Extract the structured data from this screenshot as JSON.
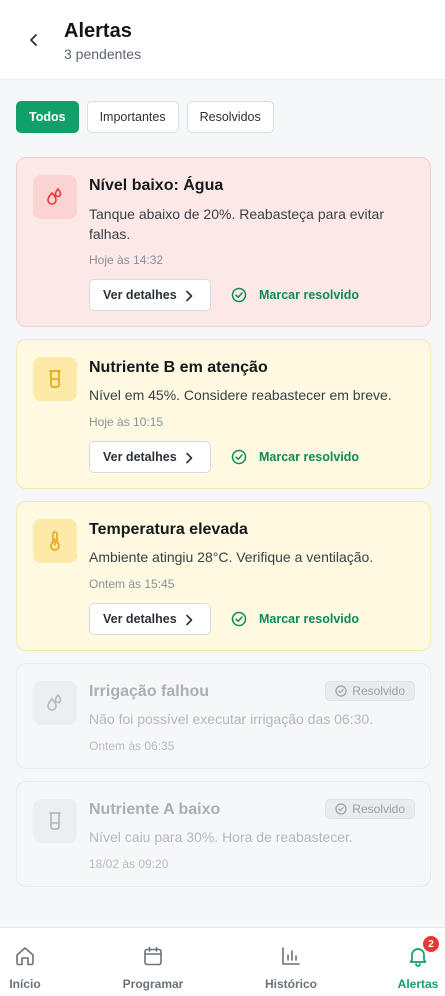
{
  "header": {
    "title": "Alertas",
    "subtitle": "3 pendentes"
  },
  "filters": [
    {
      "label": "Todos",
      "active": true
    },
    {
      "label": "Importantes",
      "active": false
    },
    {
      "label": "Resolvidos",
      "active": false
    }
  ],
  "alerts": [
    {
      "title": "Nível baixo: Água",
      "description": "Tanque abaixo de 20%. Reabasteça para evitar falhas.",
      "time": "Hoje às 14:32",
      "details_label": "Ver detalhes",
      "resolve_label": "Marcar resolvido",
      "severity": "danger",
      "icon": "water-drops-icon"
    },
    {
      "title": "Nutriente B em atenção",
      "description": "Nível em 45%. Considere reabastecer em breve.",
      "time": "Hoje às 10:15",
      "details_label": "Ver detalhes",
      "resolve_label": "Marcar resolvido",
      "severity": "warning",
      "icon": "beaker-icon"
    },
    {
      "title": "Temperatura elevada",
      "description": "Ambiente atingiu 28°C. Verifique a ventilação.",
      "time": "Ontem às 15:45",
      "details_label": "Ver detalhes",
      "resolve_label": "Marcar resolvido",
      "severity": "warning",
      "icon": "thermometer-icon"
    },
    {
      "title": "Irrigação falhou",
      "description": "Não foi possível executar irrigação das 06:30.",
      "time": "Ontem às 06:35",
      "status": "Resolvido",
      "severity": "resolved",
      "icon": "water-drops-icon"
    },
    {
      "title": "Nutriente A baixo",
      "description": "Nível caiu para 30%. Hora de reabastecer.",
      "time": "18/02 às 09:20",
      "status": "Resolvido",
      "severity": "resolved",
      "icon": "beaker-icon"
    }
  ],
  "nav": [
    {
      "label": "Início",
      "icon": "home-icon",
      "active": false
    },
    {
      "label": "Programar",
      "icon": "calendar-icon",
      "active": false
    },
    {
      "label": "Histórico",
      "icon": "bar-chart-icon",
      "active": false
    },
    {
      "label": "Alertas",
      "icon": "bell-icon",
      "active": true,
      "badge": "2"
    }
  ],
  "colors": {
    "accent": "#12a06a",
    "danger_bg": "#fde8e8",
    "warning_bg": "#fef9e1",
    "badge": "#e53935"
  }
}
